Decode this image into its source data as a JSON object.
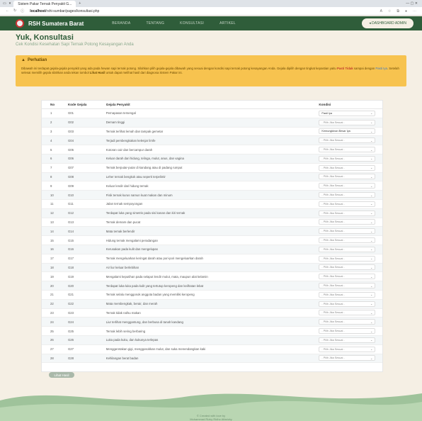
{
  "browser": {
    "tab_title": "Sistem Pakar Ternak Penyakit G...",
    "url_host": "localhost",
    "url_path": "/rshi-sumbar/pages/konsultasi.php"
  },
  "navbar": {
    "brand": "RSH Sumatera Barat",
    "menu": [
      "BERANDA",
      "TENTANG",
      "KONSULTASI",
      "ARTIKEL"
    ],
    "dashboard_btn": "DASHBOARD ADMIN"
  },
  "header": {
    "title": "Yuk, Konsultasi",
    "subtitle": "Cek Kondisi Kesehatan Sapi Ternak Potong Kesayangan Anda"
  },
  "alert": {
    "title": "Perhatian",
    "text_1": "Dibawah ini terdapat gejala-gejala penyakit yang ada pada hewan sapi ternak potong. Silahkan pilih gejala-gejala dibawah yang sesuai dengan kondisi sapi ternak potong kesayangan Anda. Gejala dipilih dengan tingkat kepastian yaitu ",
    "highlight_red": "Pasti Tidak",
    "text_2": " sampai dengan ",
    "highlight_blue": "Pasti Iya",
    "text_3": ". Setelah selesai memilih gejala silahkan anda tekan tombol ",
    "highlight_bold": "Lihat Hasil",
    "text_4": " untuk dapat melihat hasil dari diagnosa Sistem Pakar ini."
  },
  "table": {
    "headers": [
      "No",
      "Kode Gejala",
      "Gejala Penyakit",
      "Kondisi"
    ],
    "rows": [
      {
        "no": "1",
        "kode": "G01",
        "gejala": "Pernapasan tersengal",
        "kondisi": "Pasti Iya"
      },
      {
        "no": "2",
        "kode": "G02",
        "gejala": "Demam tinggi",
        "kondisi": "- Pilih Jika Sesuai -"
      },
      {
        "no": "3",
        "kode": "G03",
        "gejala": "Ternak terlihat lemah dan tampak gemetar",
        "kondisi": "Kemungkinan Besar Iya"
      },
      {
        "no": "4",
        "kode": "G04",
        "gejala": "Terjadi pembengkakan kelenjar limfe",
        "kondisi": "- Pilih Jika Sesuai -"
      },
      {
        "no": "5",
        "kode": "G05",
        "gejala": "Kotoran cair dan bercampur darah",
        "kondisi": "- Pilih Jika Sesuai -"
      },
      {
        "no": "6",
        "kode": "G06",
        "gejala": "Keluar darah dari hidung, telinga, mulut, anus, dan vagina",
        "kondisi": "- Pilih Jika Sesuai -"
      },
      {
        "no": "7",
        "kode": "G07",
        "gejala": "Ternak berputar-putar di kandang atau di padang rumput",
        "kondisi": "- Pilih Jika Sesuai -"
      },
      {
        "no": "8",
        "kode": "G08",
        "gejala": "Leher ternak bengkok atau seperti terpelintir",
        "kondisi": "- Pilih Jika Sesuai -"
      },
      {
        "no": "9",
        "kode": "G09",
        "gejala": "Keluar lendir dari hidung ternak",
        "kondisi": "- Pilih Jika Sesuai -"
      },
      {
        "no": "10",
        "kode": "G10",
        "gejala": "Fisik ternak kurus namun kuat makan dan minum",
        "kondisi": "- Pilih Jika Sesuai -"
      },
      {
        "no": "11",
        "kode": "G11",
        "gejala": "Jalan ternak sempoyongan",
        "kondisi": "- Pilih Jika Sesuai -"
      },
      {
        "no": "12",
        "kode": "G12",
        "gejala": "Terdapat luka yang simetris pada sisi kanan dan kiri ternak",
        "kondisi": "- Pilih Jika Sesuai -"
      },
      {
        "no": "13",
        "kode": "G13",
        "gejala": "Ternak demam dan pucat",
        "kondisi": "- Pilih Jika Sesuai -"
      },
      {
        "no": "14",
        "kode": "G14",
        "gejala": "Mata ternak berlendir",
        "kondisi": "- Pilih Jika Sesuai -"
      },
      {
        "no": "15",
        "kode": "G15",
        "gejala": "Hidung ternak mengalami peradangan",
        "kondisi": "- Pilih Jika Sesuai -"
      },
      {
        "no": "16",
        "kode": "G16",
        "gejala": "Kerusakan pada kulit dan mengelupas",
        "kondisi": "- Pilih Jika Sesuai -"
      },
      {
        "no": "17",
        "kode": "G17",
        "gejala": "Ternak mengeluarkan keringat darah atau pori-pori mengeluarkan darah",
        "kondisi": "- Pilih Jika Sesuai -"
      },
      {
        "no": "18",
        "kode": "G18",
        "gejala": "Air liur keluar berlebihan",
        "kondisi": "- Pilih Jika Sesuai -"
      },
      {
        "no": "19",
        "kode": "G19",
        "gejala": "Mengalami keputihan pada selaput lendir mulut, mata, maupun alat kelamin",
        "kondisi": "- Pilih Jika Sesuai -"
      },
      {
        "no": "20",
        "kode": "G20",
        "gejala": "Terdapat luka-luka pada kulit yang tertutup keropeng dan keilhatan lebat",
        "kondisi": "- Pilih Jika Sesuai -"
      },
      {
        "no": "21",
        "kode": "G21",
        "gejala": "Ternak selalu menggosok anggota badan yang memiliki keropeng",
        "kondisi": "- Pilih Jika Sesuai -"
      },
      {
        "no": "22",
        "kode": "G22",
        "gejala": "Mata membengkak, berair, dan merah",
        "kondisi": "- Pilih Jika Sesuai -"
      },
      {
        "no": "23",
        "kode": "G23",
        "gejala": "Ternak tidak nafsu makan",
        "kondisi": "- Pilih Jika Sesuai -"
      },
      {
        "no": "24",
        "kode": "G24",
        "gejala": "Liur terlihat menggantung, dan berbusa di tanah kandang",
        "kondisi": "- Pilih Jika Sesuai -"
      },
      {
        "no": "25",
        "kode": "G25",
        "gejala": "Ternak lebih sering berbaring",
        "kondisi": "- Pilih Jika Sesuai -"
      },
      {
        "no": "26",
        "kode": "G26",
        "gejala": "Luka pada kuku, dan kukunya terlepas",
        "kondisi": "- Pilih Jika Sesuai -"
      },
      {
        "no": "27",
        "kode": "G27",
        "gejala": "Menggeretakan gigi, menggosokkan mulut, dan suka menendangkan kaki",
        "kondisi": "- Pilih Jika Sesuai -"
      },
      {
        "no": "28",
        "kode": "G28",
        "gejala": "Kehilangan berat badan",
        "kondisi": "- Pilih Jika Sesuai -"
      }
    ]
  },
  "submit_label": "Lihat Hasil",
  "footer": {
    "line1": "© Created with love by",
    "line2": "Muhammad Rizky Ridho Alfarizky"
  },
  "colors": {
    "navbar": "#2f5d3a",
    "alert": "#f7c34f",
    "background": "#f5efe4"
  }
}
